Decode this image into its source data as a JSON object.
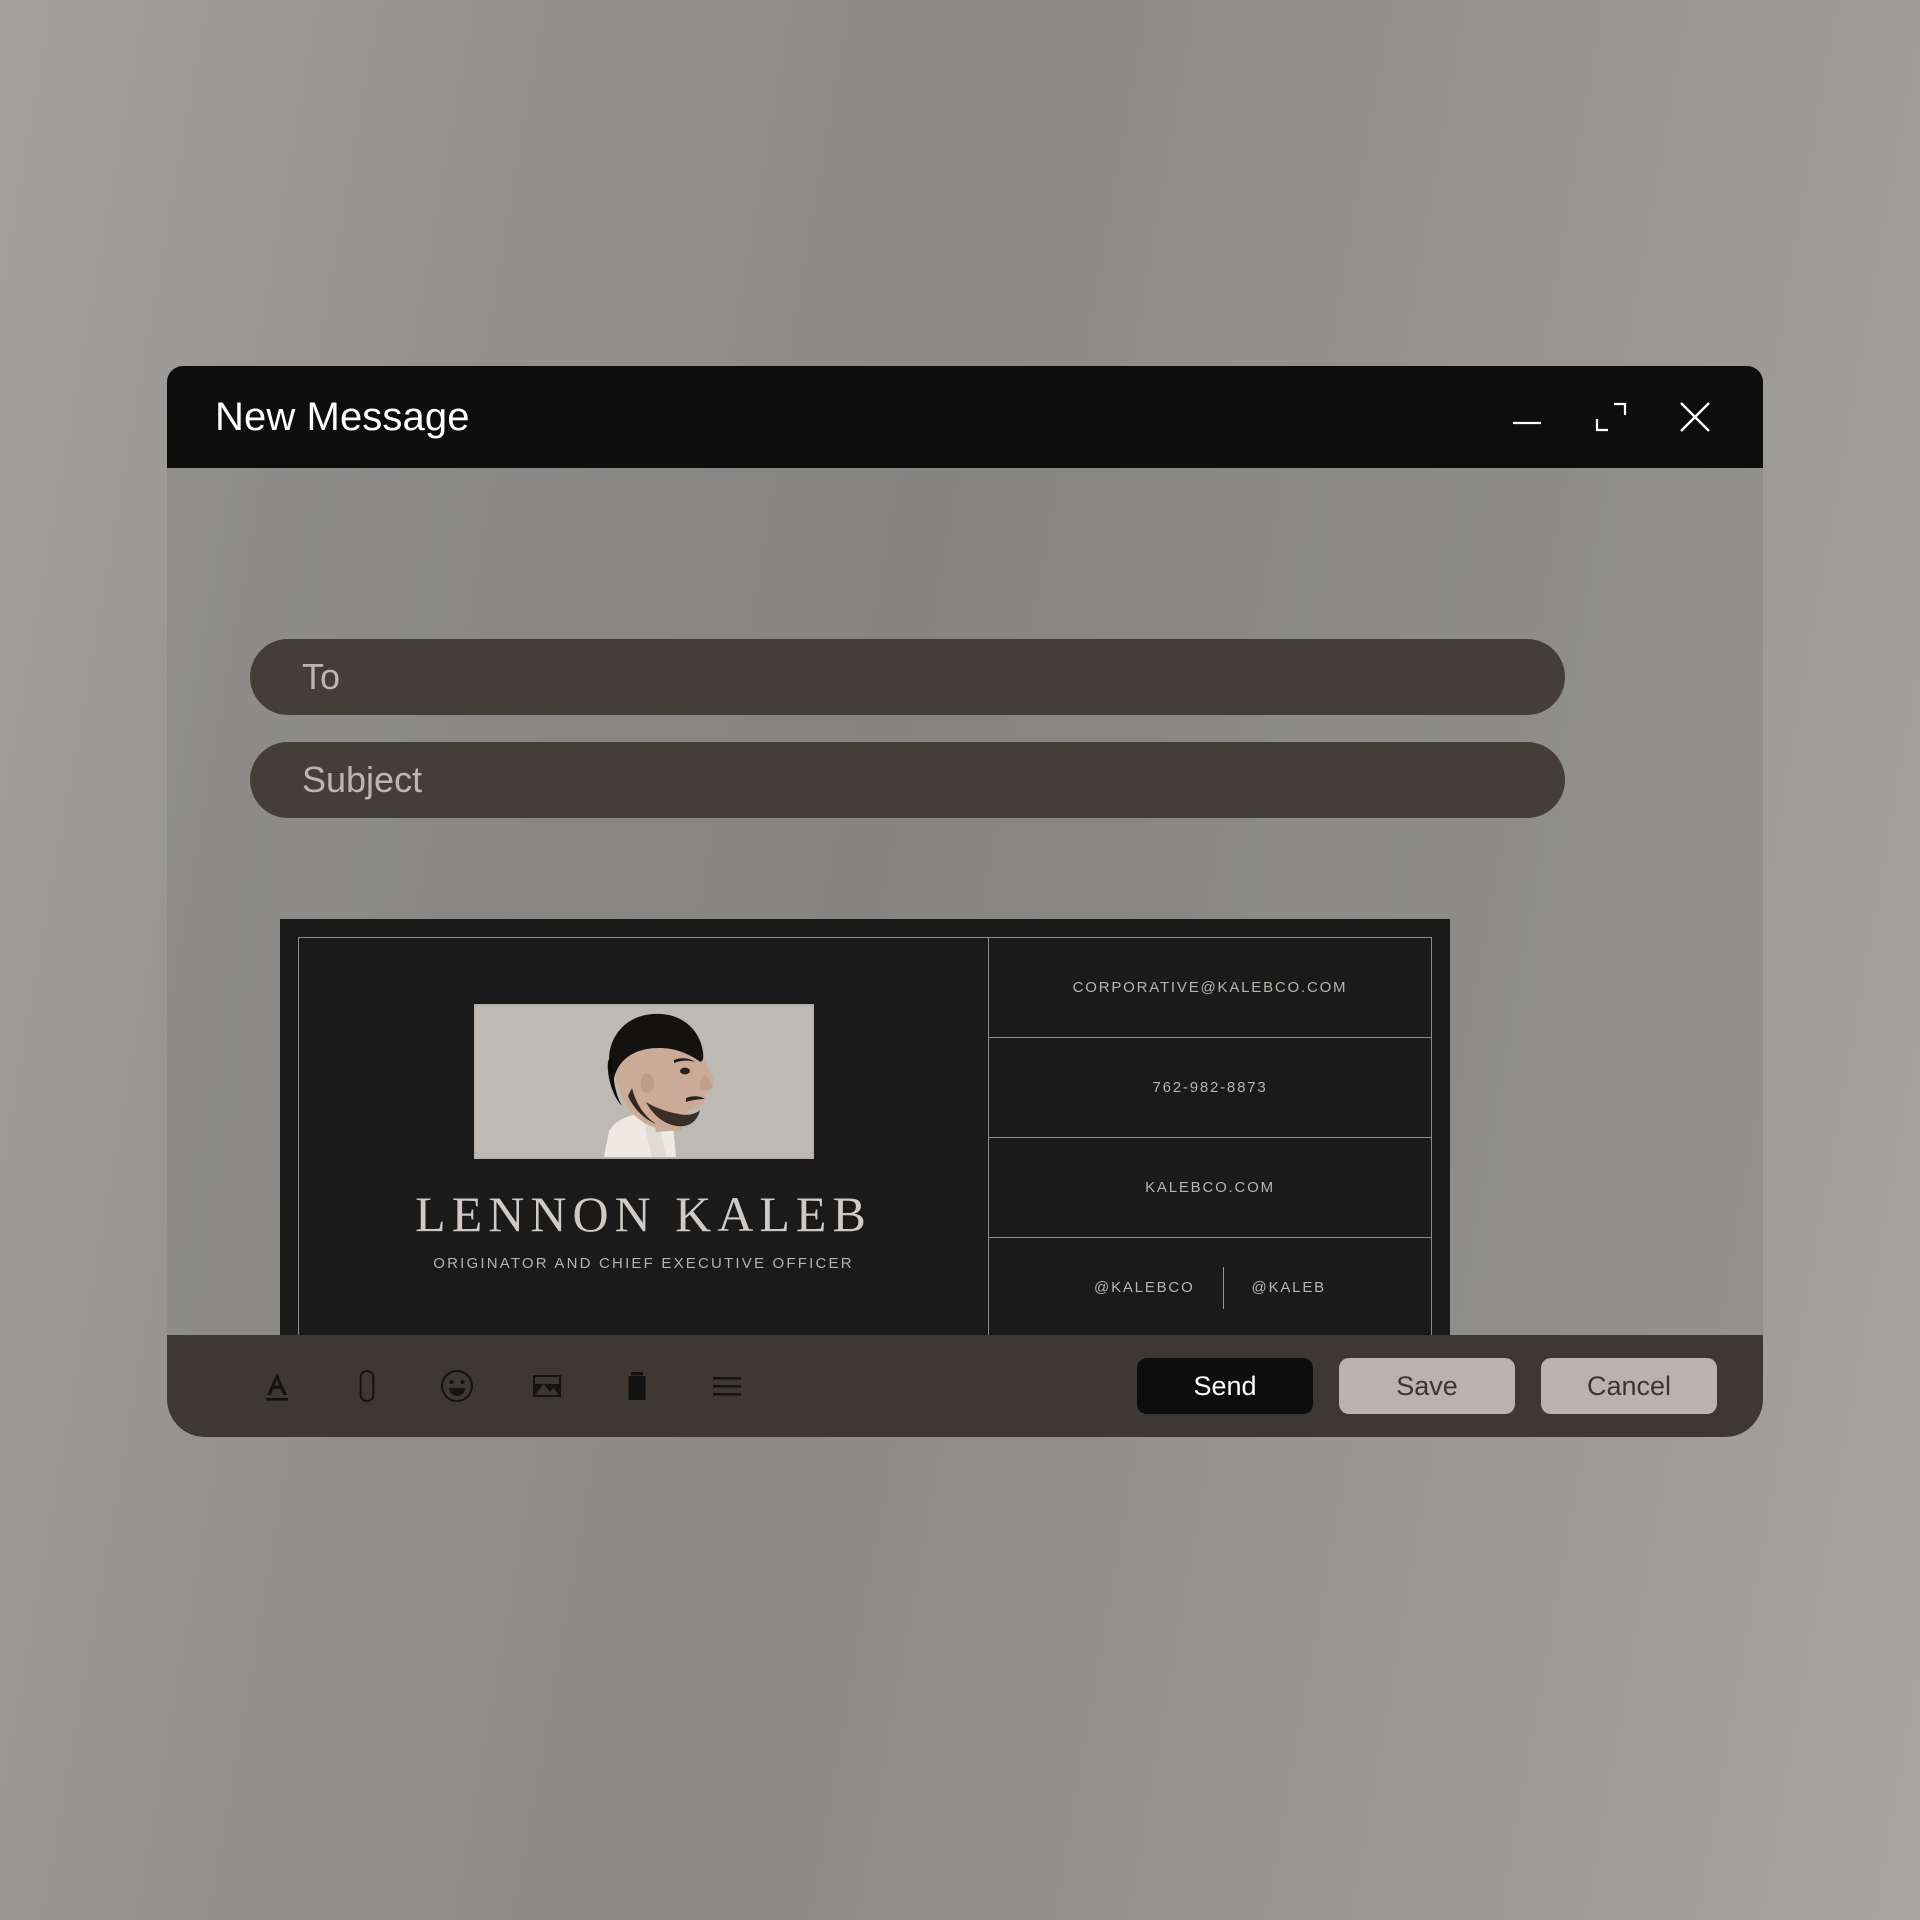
{
  "window": {
    "title": "New Message",
    "controls": [
      {
        "name": "minimize",
        "icon": "minimize-icon"
      },
      {
        "name": "maximize",
        "icon": "maximize-icon"
      },
      {
        "name": "close",
        "icon": "close-icon"
      }
    ]
  },
  "fields": {
    "to": {
      "label": "To",
      "placeholder": "To",
      "value": ""
    },
    "subject": {
      "label": "Subject",
      "placeholder": "Subject",
      "value": ""
    }
  },
  "business_card": {
    "name": "LENNON KALEB",
    "role": "ORIGINATOR AND CHIEF EXECUTIVE OFFICER",
    "photo_alt": "profile-portrait",
    "email": "CORPORATIVE@KALEBCO.COM",
    "phone": "762-982-8873",
    "website": "KALEBCO.COM",
    "social": {
      "handle_1": "@KALEBCO",
      "handle_2": "@KALEB"
    }
  },
  "toolbar": {
    "icons": [
      {
        "name": "text-format-icon",
        "label": "Text formatting"
      },
      {
        "name": "attachment-icon",
        "label": "Attach file"
      },
      {
        "name": "emoji-icon",
        "label": "Insert emoji"
      },
      {
        "name": "image-icon",
        "label": "Insert image"
      },
      {
        "name": "trash-icon",
        "label": "Discard"
      },
      {
        "name": "menu-icon",
        "label": "More options"
      }
    ]
  },
  "actions": {
    "send": "Send",
    "save": "Save",
    "cancel": "Cancel"
  },
  "colors": {
    "title_bar": "#0d0d0d",
    "field": "#443e39",
    "footer": "#3d3833",
    "card": "#1a1a1a",
    "send_button": "#0d0d0d",
    "secondary_button": "#b9b2ae",
    "page_background": "#949290"
  }
}
